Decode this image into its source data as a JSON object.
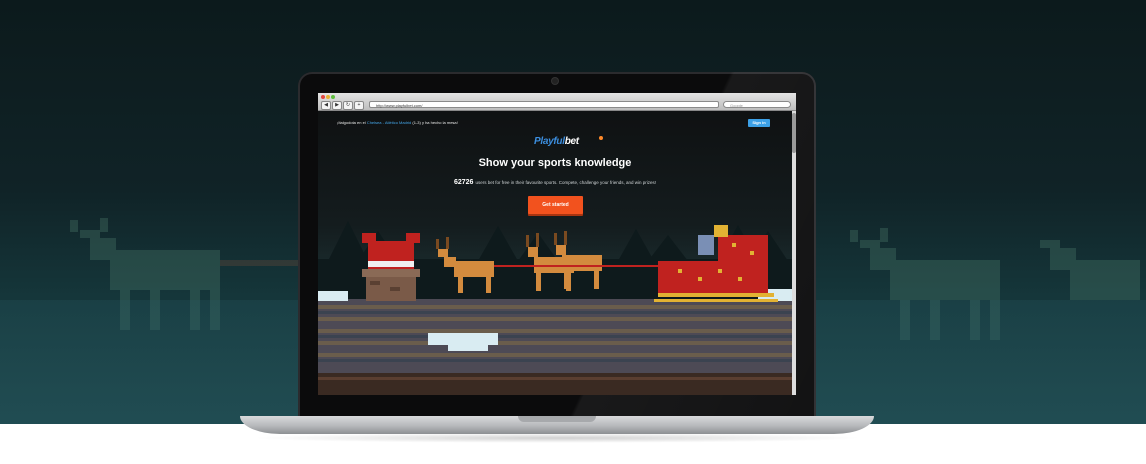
{
  "browser": {
    "url": "http://www.playfulbet.com/",
    "search_placeholder": "Google",
    "nav_buttons": [
      "◀",
      "▶",
      "↻",
      "+"
    ]
  },
  "ticker": {
    "prefix": "¡Italgodota en el",
    "match": "Chelsea - Atlético Madrid",
    "suffix": "(1-3) y ha hecho la mesa!"
  },
  "header": {
    "signin_label": "Sign in"
  },
  "logo": {
    "part1": "Playful",
    "part2": "bet"
  },
  "hero": {
    "headline": "Show your sports knowledge",
    "user_count": "62726",
    "subtitle": "users bet for free in their favourite sports. Compete, challenge your friends, and win prizes!",
    "cta_label": "Get started"
  },
  "colors": {
    "accent_blue": "#3ca0e6",
    "cta_orange": "#f2521e",
    "background_dark": "#0f1112",
    "sleigh_red": "#c0221f"
  }
}
